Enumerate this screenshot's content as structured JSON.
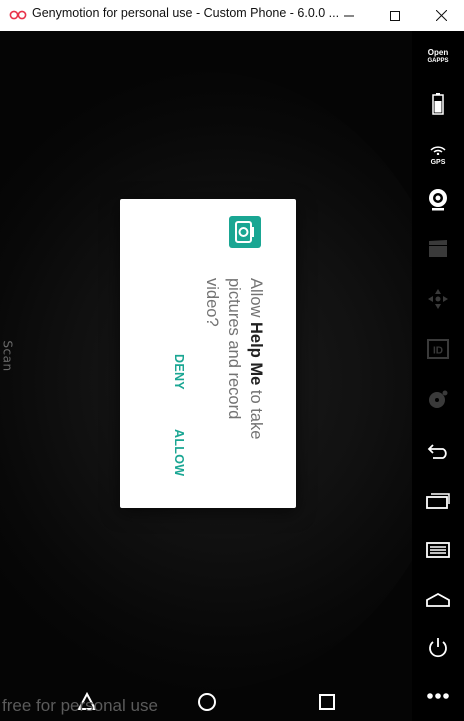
{
  "window": {
    "title": "Genymotion for personal use - Custom Phone - 6.0.0 ...",
    "minimize_icon": "minimize-icon",
    "maximize_icon": "maximize-icon",
    "close_icon": "close-icon"
  },
  "screen": {
    "side_label": "Scan",
    "watermark": "free for personal use"
  },
  "dialog": {
    "icon": "camera-icon",
    "icon_color": "#1aa693",
    "text_prefix": "Allow ",
    "app_name": "Help Me",
    "text_suffix": " to take pictures and record video?",
    "deny_label": "DENY",
    "allow_label": "ALLOW",
    "accent": "#1aa693"
  },
  "navbar": {
    "back_icon": "back-triangle-icon",
    "home_icon": "home-circle-icon",
    "recents_icon": "recents-square-icon"
  },
  "sidebar": {
    "opengapps_line1": "Open",
    "opengapps_line2": "GAPPS",
    "gps_label": "GPS",
    "items": [
      "opengapps",
      "battery-icon",
      "gps-icon",
      "webcam-icon",
      "media-clapper-icon",
      "dpad-icon",
      "device-id-icon",
      "disk-icon",
      "back-icon",
      "recent-apps-icon",
      "menu-icon",
      "home-icon",
      "power-icon",
      "more-icon"
    ]
  }
}
